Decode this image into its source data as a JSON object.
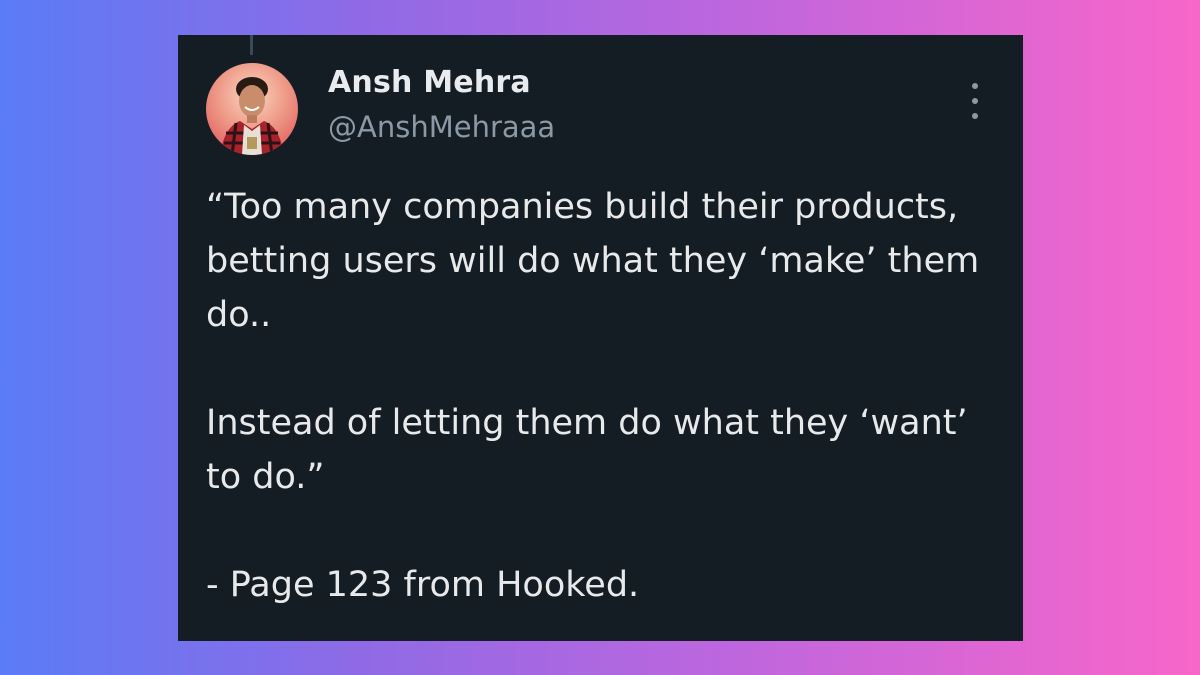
{
  "tweet": {
    "author_name": "Ansh Mehra",
    "author_handle": "@AnshMehraaa",
    "paragraphs": [
      "“Too many companies build their products, betting users will do what they ‘make’ them do..",
      "Instead of letting them do what they ‘want’ to do.”",
      "- Page 123 from Hooked."
    ]
  },
  "icons": {
    "more": "more-vertical-icon",
    "avatar": "profile-photo"
  },
  "colors": {
    "card_background": "#141d23",
    "name_color": "#e8ecef",
    "handle_color": "#8b98a5",
    "text_color": "#e7e9ea",
    "gradient_left": "#5a7cf6",
    "gradient_right": "#f866c9"
  }
}
